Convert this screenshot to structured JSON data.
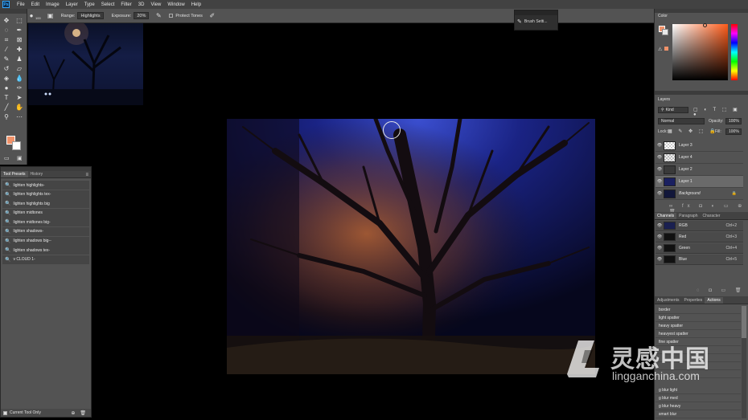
{
  "app": {
    "logo_text": "Ps"
  },
  "menu": [
    "File",
    "Edit",
    "Image",
    "Layer",
    "Type",
    "Select",
    "Filter",
    "3D",
    "View",
    "Window",
    "Help"
  ],
  "options": {
    "brush_size": "100",
    "range_label": "Range:",
    "range_value": "Highlights",
    "exposure_label": "Exposure:",
    "exposure_value": "20%",
    "protect_tones": "Protect Tones"
  },
  "brush_panel": {
    "label": "Brush Setti..."
  },
  "tool_presets": {
    "tabs": [
      "Tool Presets",
      "History"
    ],
    "items": [
      "lighten highlights-",
      "lighten highlights tex-",
      "lighten highlights big",
      "lighten midtones",
      "lighten midtones big-",
      "lighten shadows-",
      "lighten shadows big--",
      "lighten shadows tex-",
      "v CLOUD 1-"
    ],
    "footer": "Current Tool Only"
  },
  "color_panel": {
    "title": "Color",
    "fg": "#f0926a",
    "bg": "#e8e8e8"
  },
  "layers_panel": {
    "title": "Layers",
    "kind": "Kind",
    "blend_mode": "Normal",
    "opacity_label": "Opacity:",
    "opacity": "100%",
    "lock_label": "Lock:",
    "fill_label": "Fill:",
    "fill": "100%",
    "layers": [
      {
        "name": "Layer 3"
      },
      {
        "name": "Layer 4"
      },
      {
        "name": "Layer 2"
      },
      {
        "name": "Layer 1"
      },
      {
        "name": "Background"
      }
    ]
  },
  "channels_panel": {
    "tabs": [
      "Channels",
      "Paragraph",
      "Character"
    ],
    "channels": [
      {
        "name": "RGB",
        "shortcut": "Ctrl+2"
      },
      {
        "name": "Red",
        "shortcut": "Ctrl+3"
      },
      {
        "name": "Green",
        "shortcut": "Ctrl+4"
      },
      {
        "name": "Blue",
        "shortcut": "Ctrl+5"
      }
    ]
  },
  "actions_panel": {
    "tabs": [
      "Adjustments",
      "Properties",
      "Actions"
    ],
    "actions": [
      "border",
      "light spatter",
      "heavy spatter",
      "heavyest spatter",
      "fine spatter",
      "",
      "",
      "",
      "",
      "g blur light",
      "g blur med",
      "g blur heavy",
      "smart blur"
    ]
  },
  "watermark": {
    "brand_cn": "灵感中国",
    "brand_url": "lingganchina.com"
  }
}
